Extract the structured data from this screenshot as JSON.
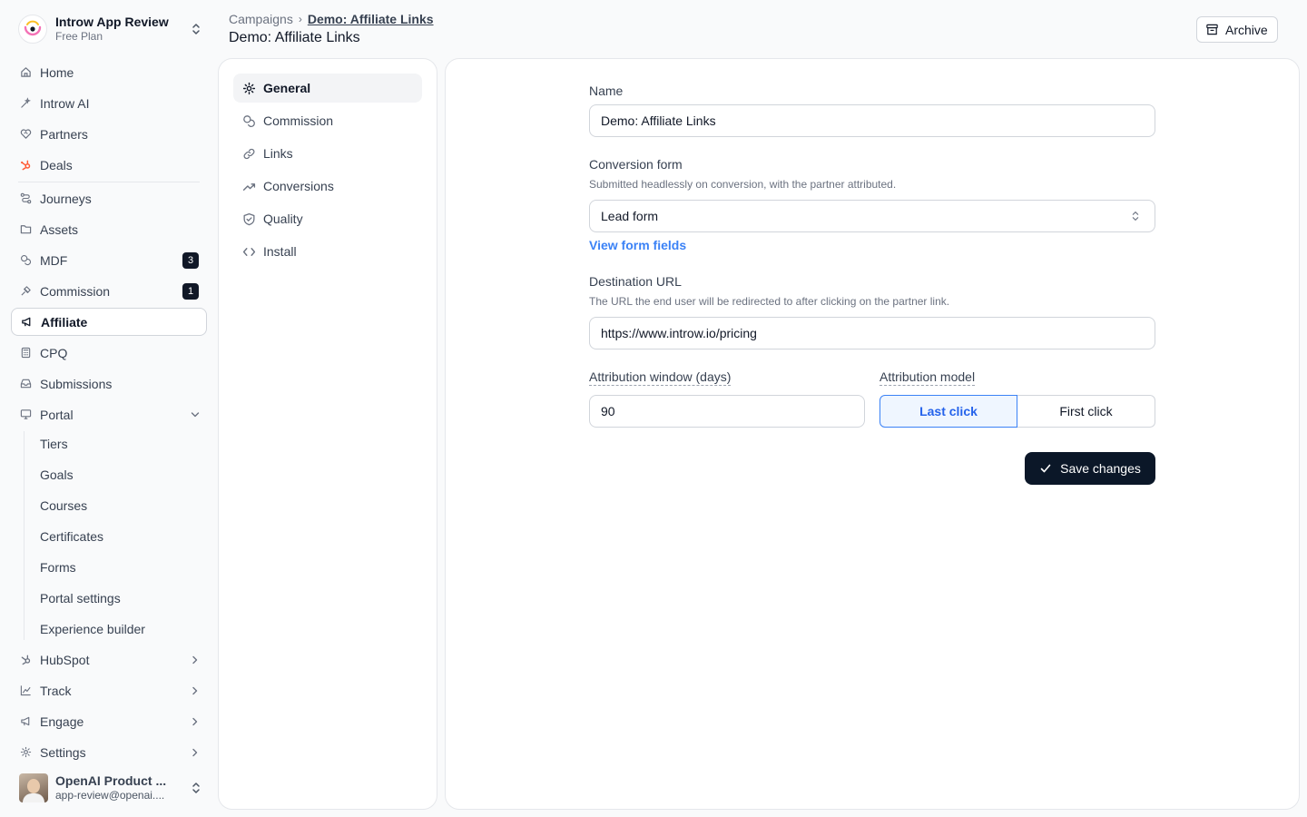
{
  "workspace": {
    "name": "Introw App Review",
    "plan": "Free Plan"
  },
  "sidebar": {
    "items": [
      {
        "label": "Home",
        "icon": "home-icon"
      },
      {
        "label": "Introw AI",
        "icon": "sparkle-icon"
      },
      {
        "label": "Partners",
        "icon": "handshake-icon"
      },
      {
        "label": "Deals",
        "icon": "hubspot-icon"
      },
      {
        "label": "Journeys",
        "icon": "route-icon"
      },
      {
        "label": "Assets",
        "icon": "folder-icon"
      },
      {
        "label": "MDF",
        "icon": "coins-icon",
        "badge": "3"
      },
      {
        "label": "Commission",
        "icon": "dollar-icon",
        "badge": "1"
      },
      {
        "label": "Affiliate",
        "icon": "megaphone-icon"
      },
      {
        "label": "CPQ",
        "icon": "calculator-icon"
      },
      {
        "label": "Submissions",
        "icon": "inbox-icon"
      },
      {
        "label": "Portal",
        "icon": "monitor-icon"
      }
    ],
    "portal_sub": [
      "Tiers",
      "Goals",
      "Courses",
      "Certificates",
      "Forms",
      "Portal settings",
      "Experience builder"
    ],
    "groups": [
      {
        "label": "HubSpot",
        "icon": "hubspot-icon"
      },
      {
        "label": "Track",
        "icon": "chart-line-icon"
      },
      {
        "label": "Engage",
        "icon": "megaphone-icon"
      },
      {
        "label": "Settings",
        "icon": "gear-icon"
      }
    ]
  },
  "user": {
    "name": "OpenAI Product ...",
    "email": "app-review@openai...."
  },
  "header": {
    "breadcrumb_root": "Campaigns",
    "breadcrumb_current": "Demo: Affiliate Links",
    "title": "Demo: Affiliate Links",
    "archive_label": "Archive"
  },
  "settings_nav": [
    {
      "label": "General",
      "icon": "gear-icon"
    },
    {
      "label": "Commission",
      "icon": "coins-icon"
    },
    {
      "label": "Links",
      "icon": "link-icon"
    },
    {
      "label": "Conversions",
      "icon": "trending-up-icon"
    },
    {
      "label": "Quality",
      "icon": "shield-check-icon"
    },
    {
      "label": "Install",
      "icon": "code-icon"
    }
  ],
  "form": {
    "name_label": "Name",
    "name_value": "Demo: Affiliate Links",
    "conversion_label": "Conversion form",
    "conversion_desc": "Submitted headlessly on conversion, with the partner attributed.",
    "conversion_value": "Lead form",
    "view_fields_link": "View form fields",
    "destination_label": "Destination URL",
    "destination_desc": "The URL the end user will be redirected to after clicking on the partner link.",
    "destination_value": "https://www.introw.io/pricing",
    "window_label": "Attribution window (days)",
    "window_value": "90",
    "model_label": "Attribution model",
    "model_options": [
      "Last click",
      "First click"
    ],
    "model_selected": "Last click",
    "save_label": "Save changes"
  },
  "colors": {
    "accent": "#3b82f6",
    "primary_button": "#0b1728",
    "hubspot": "#ff5c35"
  }
}
